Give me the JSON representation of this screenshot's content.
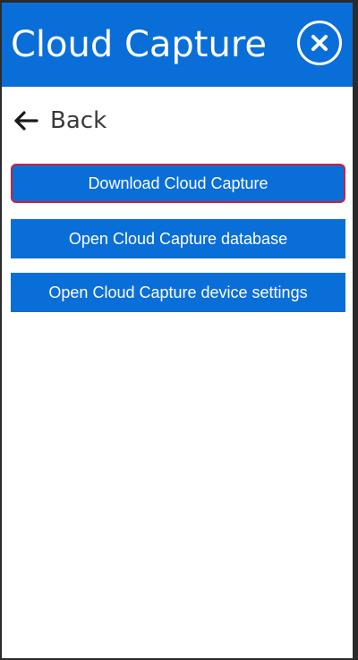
{
  "header": {
    "title": "Cloud Capture"
  },
  "nav": {
    "back_label": "Back"
  },
  "actions": [
    {
      "label": "Download Cloud Capture",
      "focused": true
    },
    {
      "label": "Open Cloud Capture database",
      "focused": false
    },
    {
      "label": "Open Cloud Capture device settings",
      "focused": false
    }
  ],
  "colors": {
    "accent": "#0a6ed8",
    "focus_ring": "#d0203a",
    "background": "#ffffff",
    "window_frame": "#2b2b2b"
  },
  "icons": {
    "close": "close-icon",
    "back": "arrow-left-icon"
  }
}
